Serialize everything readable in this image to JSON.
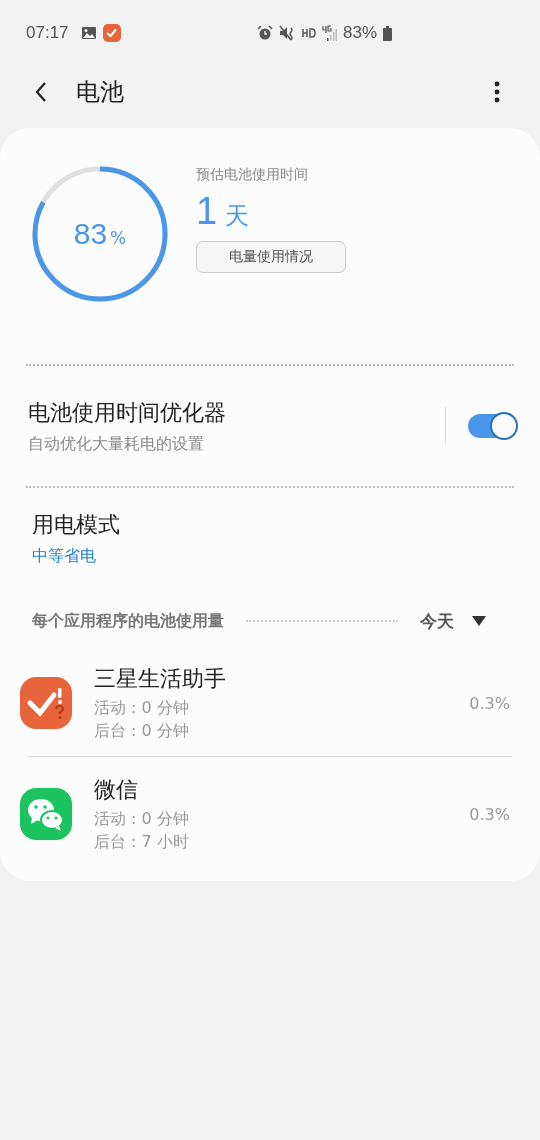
{
  "status_bar": {
    "time": "07:17",
    "battery_text": "83%"
  },
  "header": {
    "title": "电池"
  },
  "battery": {
    "level": 0.83,
    "percent": "83",
    "percent_sign": "%",
    "estimate_label": "预估电池使用时间",
    "estimate_value": "1",
    "estimate_unit": "天",
    "usage_button": "电量使用情况"
  },
  "optimizer": {
    "title": "电池使用时间优化器",
    "subtitle": "自动优化大量耗电的设置",
    "on": true
  },
  "power_mode": {
    "title": "用电模式",
    "value": "中等省电"
  },
  "app_usage": {
    "heading": "每个应用程序的电池使用量",
    "period": "今天"
  },
  "apps": [
    {
      "kind": "tasks",
      "name": "三星生活助手",
      "active": "活动 : 0 分钟",
      "background": "后台 : 0 分钟",
      "share": "0.3%"
    },
    {
      "kind": "chat",
      "name": "微信",
      "active": "活动 : 0 分钟",
      "background": "后台 : 7 小时",
      "share": "0.3%"
    }
  ]
}
